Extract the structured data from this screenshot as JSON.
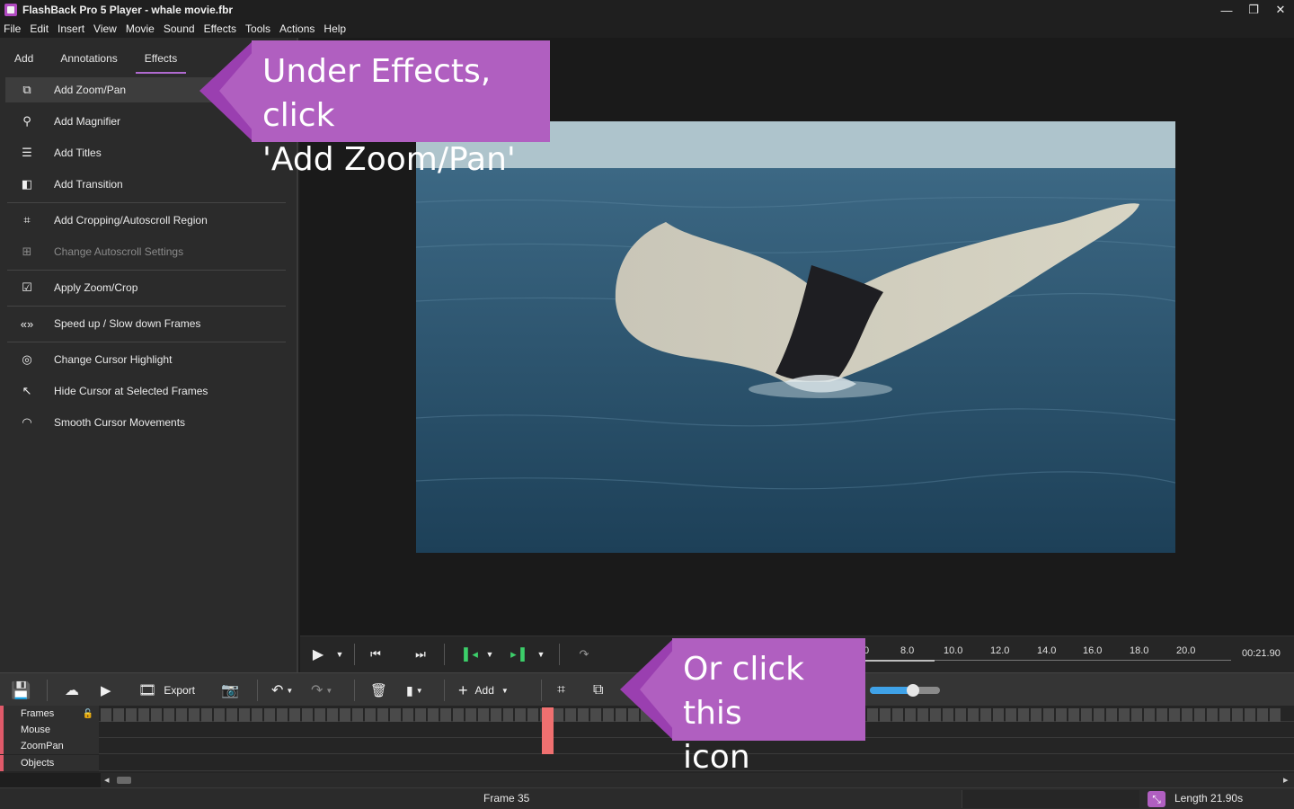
{
  "window": {
    "title": "FlashBack Pro 5 Player - whale movie.fbr",
    "min_glyph": "—",
    "max_glyph": "❐",
    "close_glyph": "✕"
  },
  "menu": [
    "File",
    "Edit",
    "Insert",
    "View",
    "Movie",
    "Sound",
    "Effects",
    "Tools",
    "Actions",
    "Help"
  ],
  "tabs": [
    {
      "label": "Add",
      "active": false
    },
    {
      "label": "Annotations",
      "active": false
    },
    {
      "label": "Effects",
      "active": true
    }
  ],
  "effects": {
    "items": [
      {
        "label": "Add Zoom/Pan",
        "icon": "zoompan-icon",
        "glyph": "⧉",
        "selected": true,
        "disabled": false
      },
      {
        "label": "Add Magnifier",
        "icon": "magnifier-icon",
        "glyph": "⚲",
        "selected": false,
        "disabled": false
      },
      {
        "label": "Add Titles",
        "icon": "titles-icon",
        "glyph": "☰",
        "selected": false,
        "disabled": false
      },
      {
        "label": "Add Transition",
        "icon": "transition-icon",
        "glyph": "◧",
        "selected": false,
        "disabled": false
      },
      {
        "label": "Add Cropping/Autoscroll Region",
        "icon": "crop-icon",
        "glyph": "⌗",
        "selected": false,
        "disabled": false
      },
      {
        "label": "Change Autoscroll Settings",
        "icon": "autoscroll-icon",
        "glyph": "⊞",
        "selected": false,
        "disabled": true
      },
      {
        "label": "Apply Zoom/Crop",
        "icon": "checkbox-icon",
        "glyph": "☑",
        "selected": false,
        "disabled": false
      },
      {
        "label": "Speed up / Slow down Frames",
        "icon": "speed-icon",
        "glyph": "«»",
        "selected": false,
        "disabled": false
      },
      {
        "label": "Change Cursor Highlight",
        "icon": "cursor-highlight-icon",
        "glyph": "◎",
        "selected": false,
        "disabled": false
      },
      {
        "label": "Hide Cursor at Selected Frames",
        "icon": "cursor-icon",
        "glyph": "↖",
        "selected": false,
        "disabled": false
      },
      {
        "label": "Smooth Cursor Movements",
        "icon": "smooth-cursor-icon",
        "glyph": "◠",
        "selected": false,
        "disabled": false
      }
    ]
  },
  "timeline": {
    "ticks": [
      "0",
      "8.0",
      "10.0",
      "12.0",
      "14.0",
      "16.0",
      "18.0",
      "20.0"
    ],
    "time": "00:21.90"
  },
  "toolbar": {
    "export_label": "Export",
    "add_label": "Add",
    "zoom_slider_value": 0.62
  },
  "tracks": [
    "Frames",
    "Mouse",
    "ZoomPan",
    "Objects"
  ],
  "status": {
    "frame": "Frame 35",
    "length": "Length 21.90s"
  },
  "callouts": {
    "top": {
      "line1": "Under Effects, click",
      "line2": "'Add Zoom/Pan'"
    },
    "bottom": {
      "line1": "Or click this",
      "line2": "icon"
    }
  },
  "colors": {
    "accent": "#b05fc0",
    "marker": "#f07070",
    "track_bar": "#e05a6a"
  }
}
